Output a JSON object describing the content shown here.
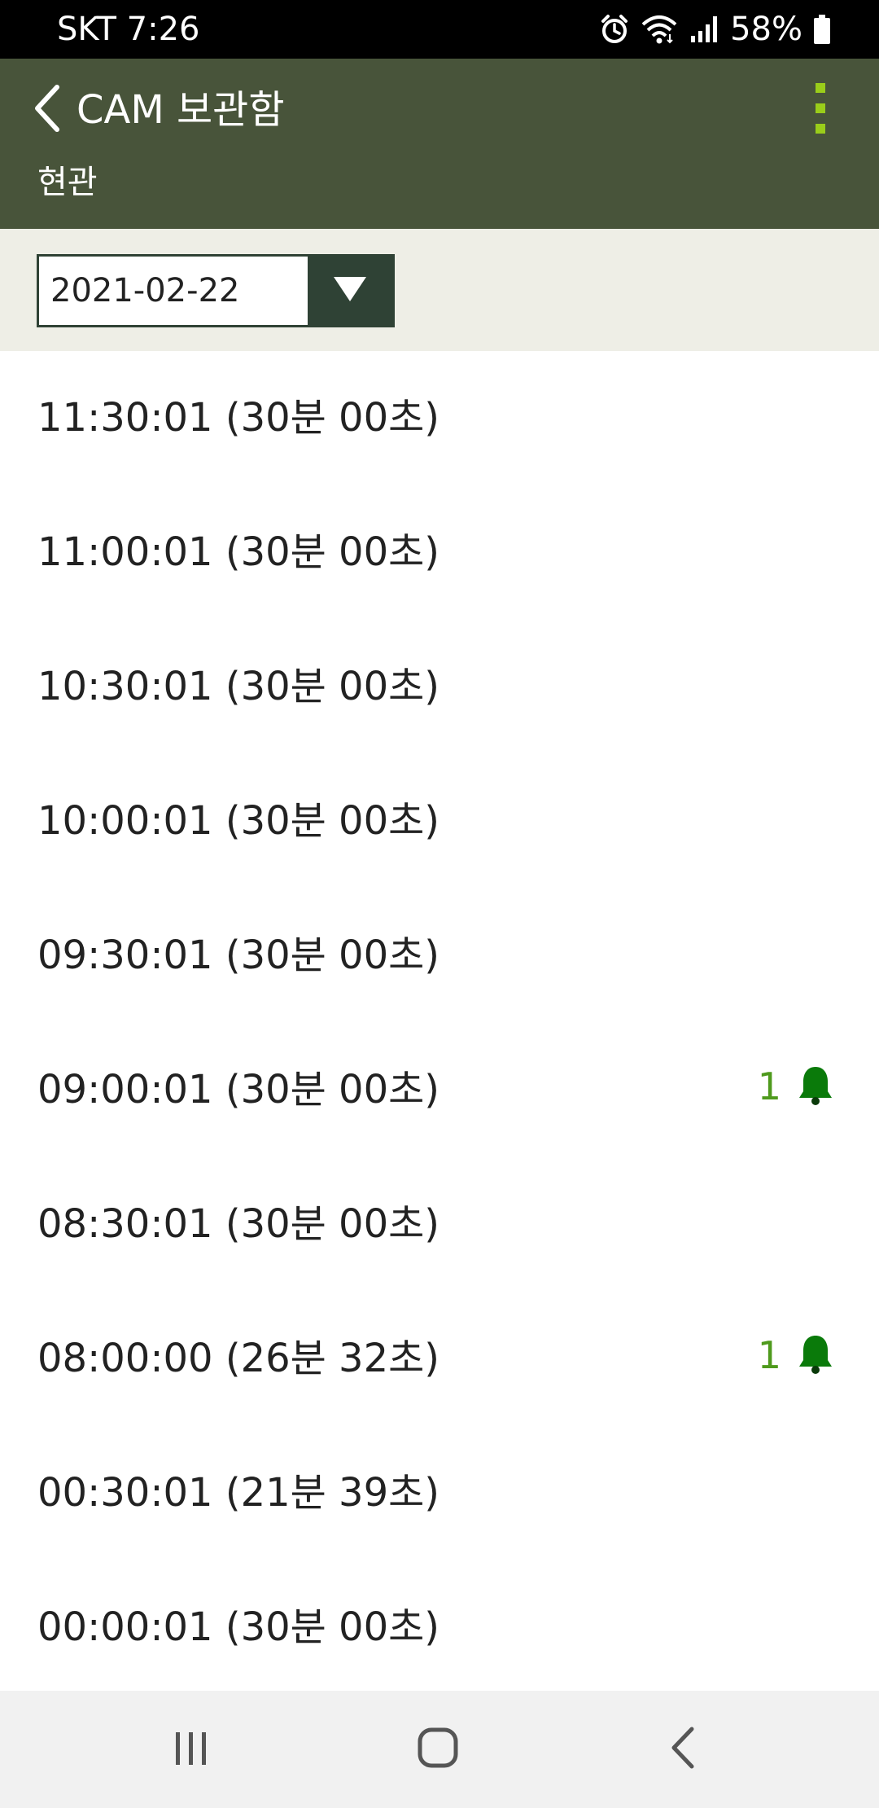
{
  "status_bar": {
    "carrier_time": "SKT 7:26",
    "battery": "58%",
    "icons": [
      "alarm-icon",
      "wifi-icon",
      "signal-icon",
      "battery-icon"
    ]
  },
  "app_bar": {
    "title": "CAM 보관함",
    "subtitle": "현관",
    "icons": [
      "back-arrow-icon",
      "overflow-menu-icon"
    ]
  },
  "date_selector": {
    "value": "2021-02-22"
  },
  "colors": {
    "app_bar": "#48543a",
    "date_area": "#eeeee6",
    "date_button": "#2f4235",
    "overflow_dots": "#9acd1a",
    "alert_green": "#0a7a0a",
    "alert_count": "#4f9a1d"
  },
  "recordings": [
    {
      "label": "11:30:01 (30분 00초)",
      "alerts": ""
    },
    {
      "label": "11:00:01 (30분 00초)",
      "alerts": ""
    },
    {
      "label": "10:30:01 (30분 00초)",
      "alerts": ""
    },
    {
      "label": "10:00:01 (30분 00초)",
      "alerts": ""
    },
    {
      "label": "09:30:01 (30분 00초)",
      "alerts": ""
    },
    {
      "label": "09:00:01 (30분 00초)",
      "alerts": "1"
    },
    {
      "label": "08:30:01 (30분 00초)",
      "alerts": ""
    },
    {
      "label": "08:00:00 (26분 32초)",
      "alerts": "1"
    },
    {
      "label": "00:30:01 (21분 39초)",
      "alerts": ""
    },
    {
      "label": "00:00:01 (30분 00초)",
      "alerts": ""
    }
  ],
  "nav_bar": {
    "icons": [
      "recents-icon",
      "home-icon",
      "back-icon"
    ]
  }
}
